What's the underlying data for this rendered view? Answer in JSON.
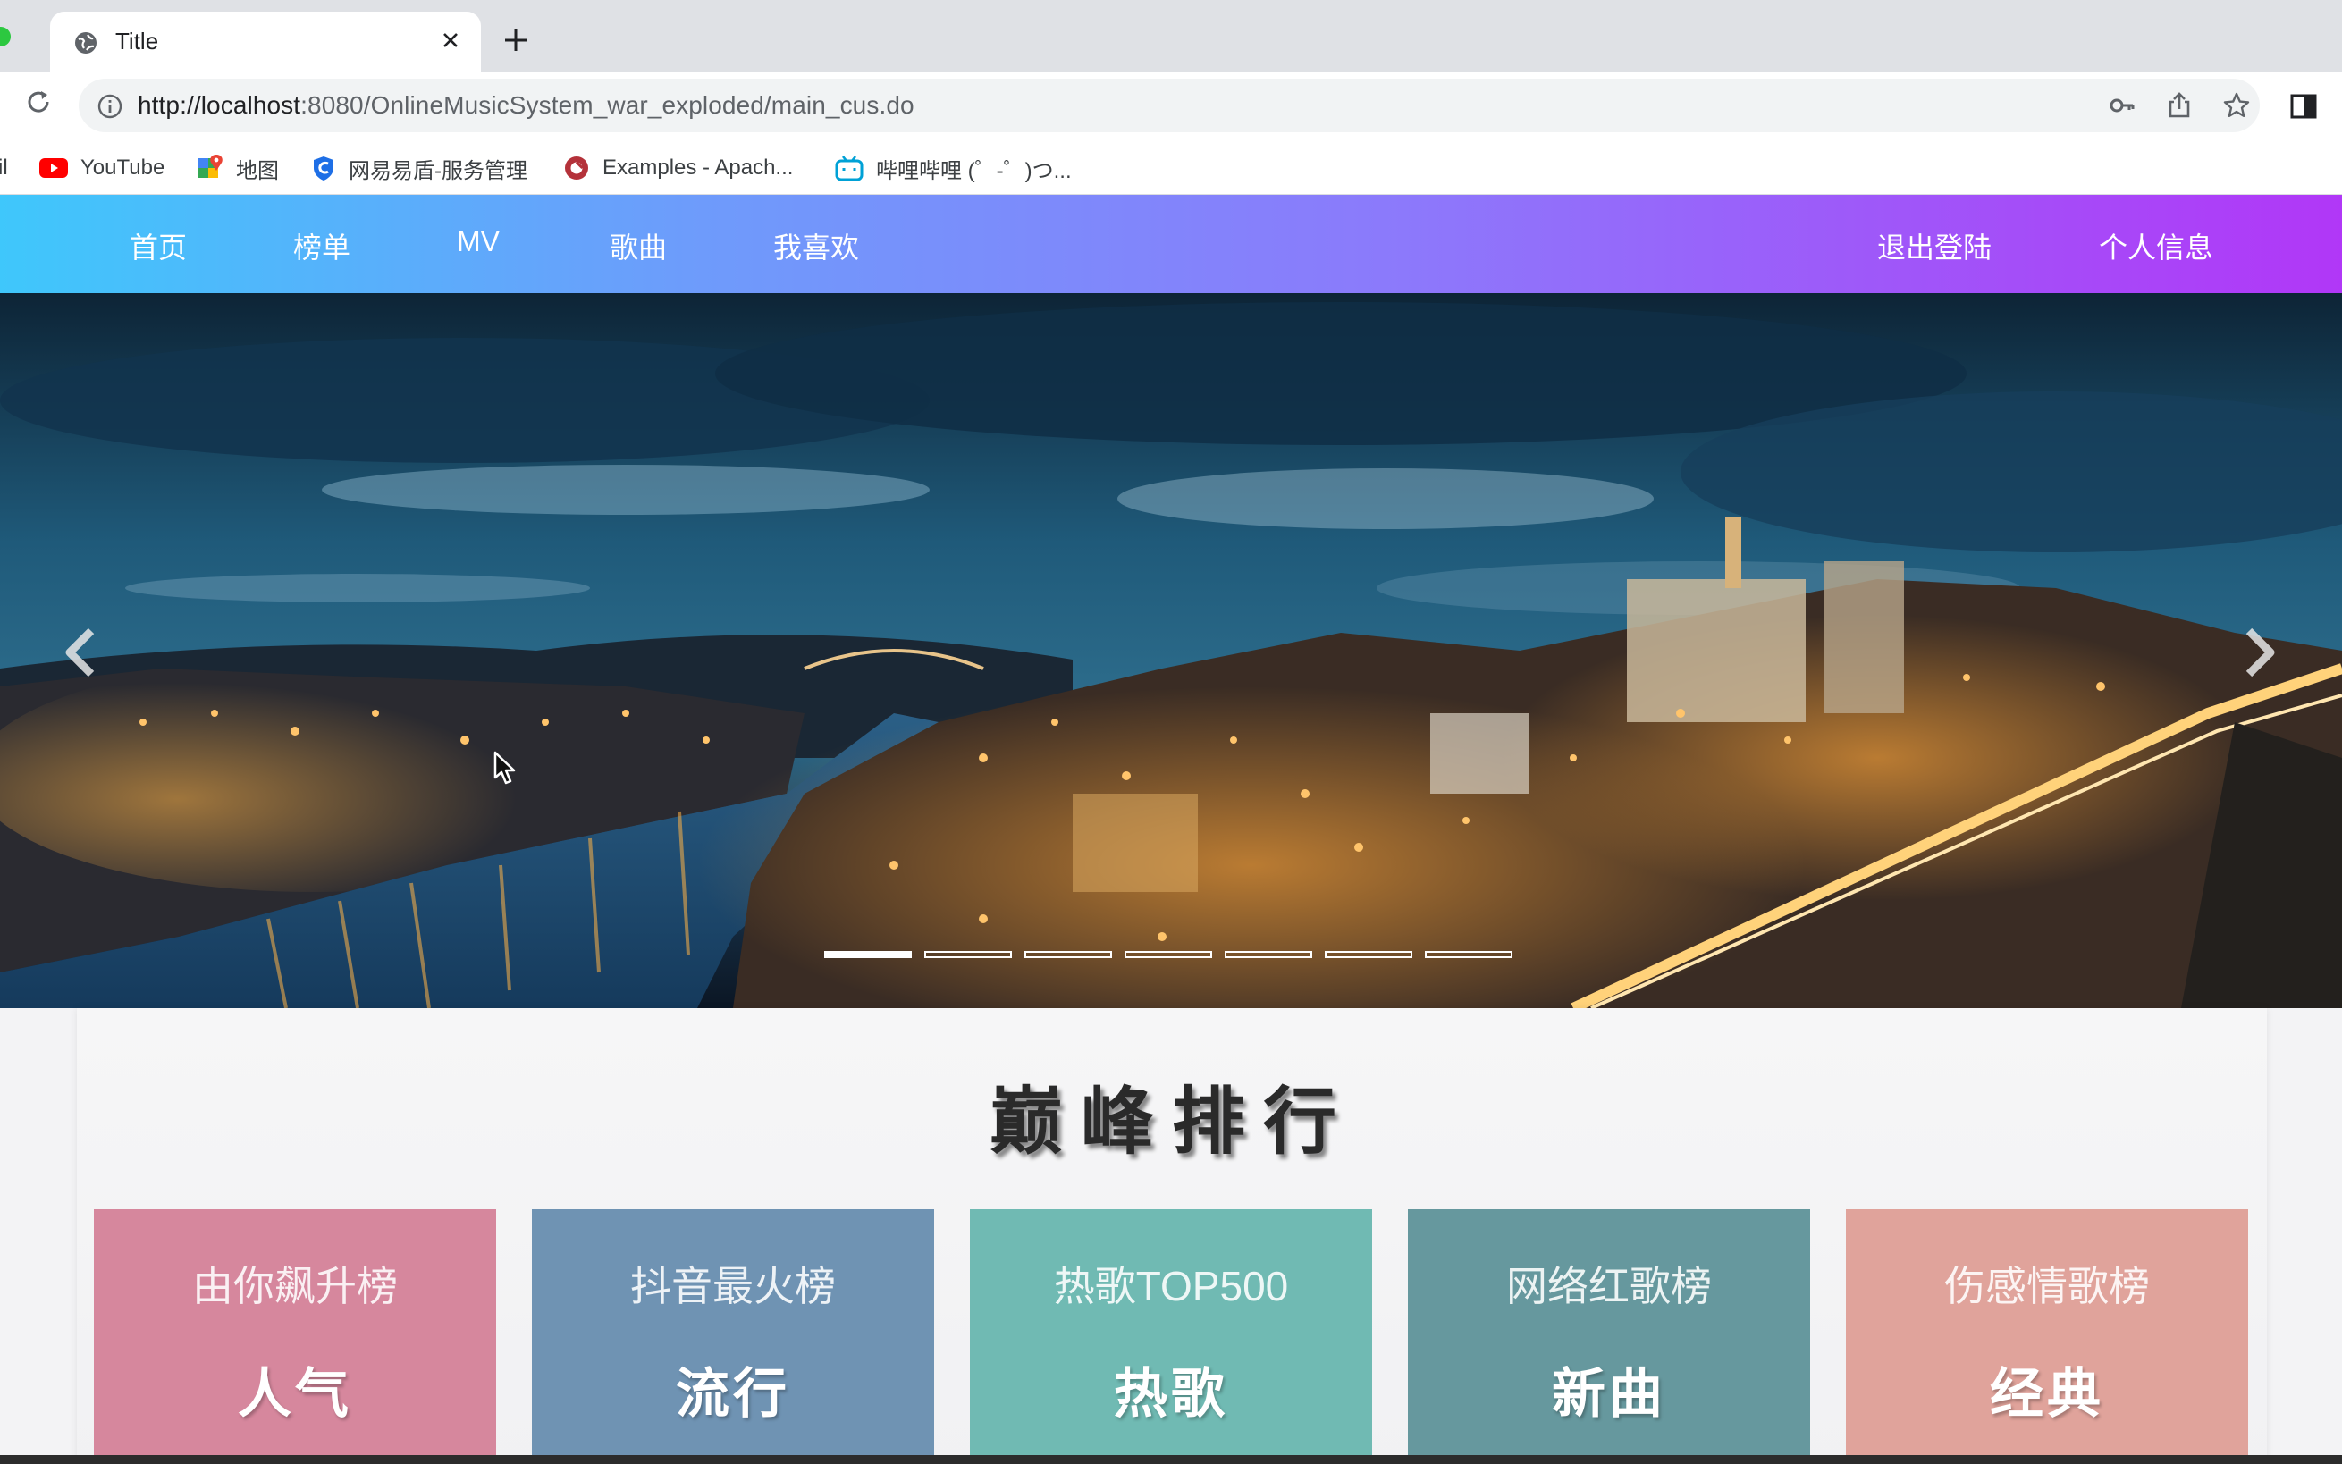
{
  "browser": {
    "tab_title": "Title",
    "url_host": "http://localhost",
    "url_rest": ":8080/OnlineMusicSystem_war_exploded/main_cus.do",
    "bookmarks": [
      {
        "label": "il"
      },
      {
        "label": "YouTube"
      },
      {
        "label": "地图"
      },
      {
        "label": "网易易盾-服务管理"
      },
      {
        "label": "Examples - Apach..."
      },
      {
        "label": "哔哩哔哩 (゜-゜)つ..."
      }
    ]
  },
  "nav": {
    "left": [
      "首页",
      "榜单",
      "MV",
      "歌曲",
      "我喜欢"
    ],
    "right": [
      "退出登陆",
      "个人信息"
    ]
  },
  "carousel": {
    "slide_count": 7,
    "active_index": 0
  },
  "ranking": {
    "title": "巅峰排行",
    "cards": [
      {
        "name": "由你飙升榜",
        "tag": "人气",
        "color": "#d6879d"
      },
      {
        "name": "抖音最火榜",
        "tag": "流行",
        "color": "#6f93b3"
      },
      {
        "name": "热歌TOP500",
        "tag": "热歌",
        "color": "#70bab3"
      },
      {
        "name": "网络红歌榜",
        "tag": "新曲",
        "color": "#66989e"
      },
      {
        "name": "伤感情歌榜",
        "tag": "经典",
        "color": "#e0a39b"
      }
    ]
  },
  "colors": {
    "nav_gradient_start": "#3fc7fb",
    "nav_gradient_end": "#b137f7"
  }
}
